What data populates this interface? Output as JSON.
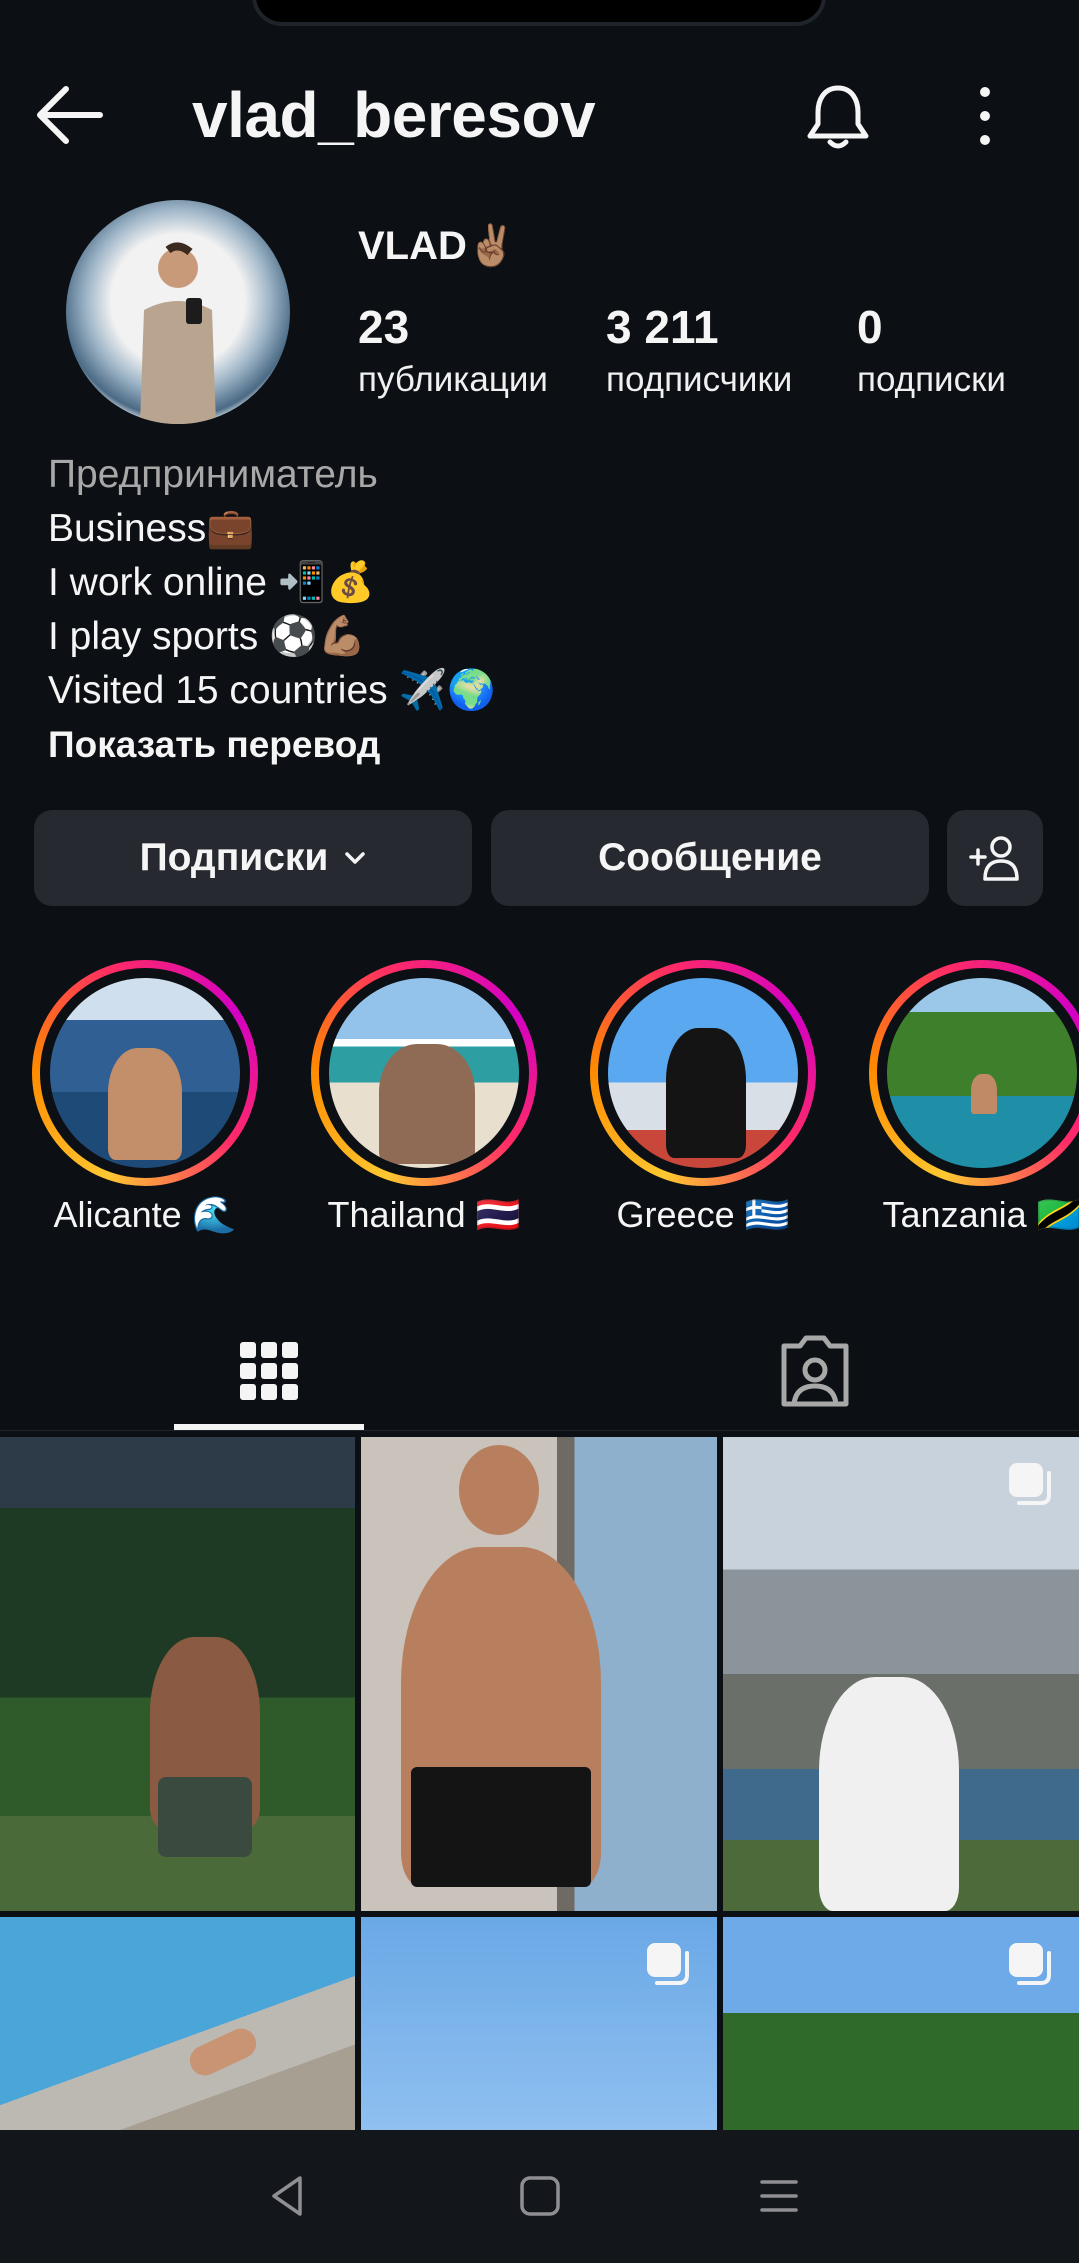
{
  "header": {
    "username": "vlad_beresov"
  },
  "profile": {
    "display_name": "VLAD✌🏽",
    "stats": [
      {
        "value": "23",
        "label": "публикации"
      },
      {
        "value": "3 211",
        "label": "подписчики"
      },
      {
        "value": "0",
        "label": "подписки"
      }
    ],
    "bio": {
      "category": "Предприниматель",
      "lines": [
        "Business💼",
        "I work online 📲💰",
        "I play sports ⚽💪🏽",
        "Visited 15 countries ✈️🌍"
      ],
      "translate": "Показать перевод"
    }
  },
  "actions": {
    "following_label": "Подписки",
    "message_label": "Сообщение"
  },
  "highlights": [
    {
      "label": "Alicante 🌊"
    },
    {
      "label": "Thailand 🇹🇭"
    },
    {
      "label": "Greece 🇬🇷"
    },
    {
      "label": "Tanzania 🇹🇿"
    }
  ],
  "tabs": [
    {
      "name": "grid",
      "icon": "grid-icon",
      "active": true
    },
    {
      "name": "tagged",
      "icon": "tagged-user-icon",
      "active": false
    }
  ],
  "icons": {
    "back": "arrow-left-icon",
    "notifications": "bell-icon",
    "more": "more-vertical-icon",
    "add_user": "add-user-icon",
    "multi_post": "carousel-icon"
  },
  "colors": {
    "background": "#0c1014",
    "button": "#262a30",
    "story_ring": [
      "#fdc831",
      "#ff2a68",
      "#d300c5"
    ]
  }
}
